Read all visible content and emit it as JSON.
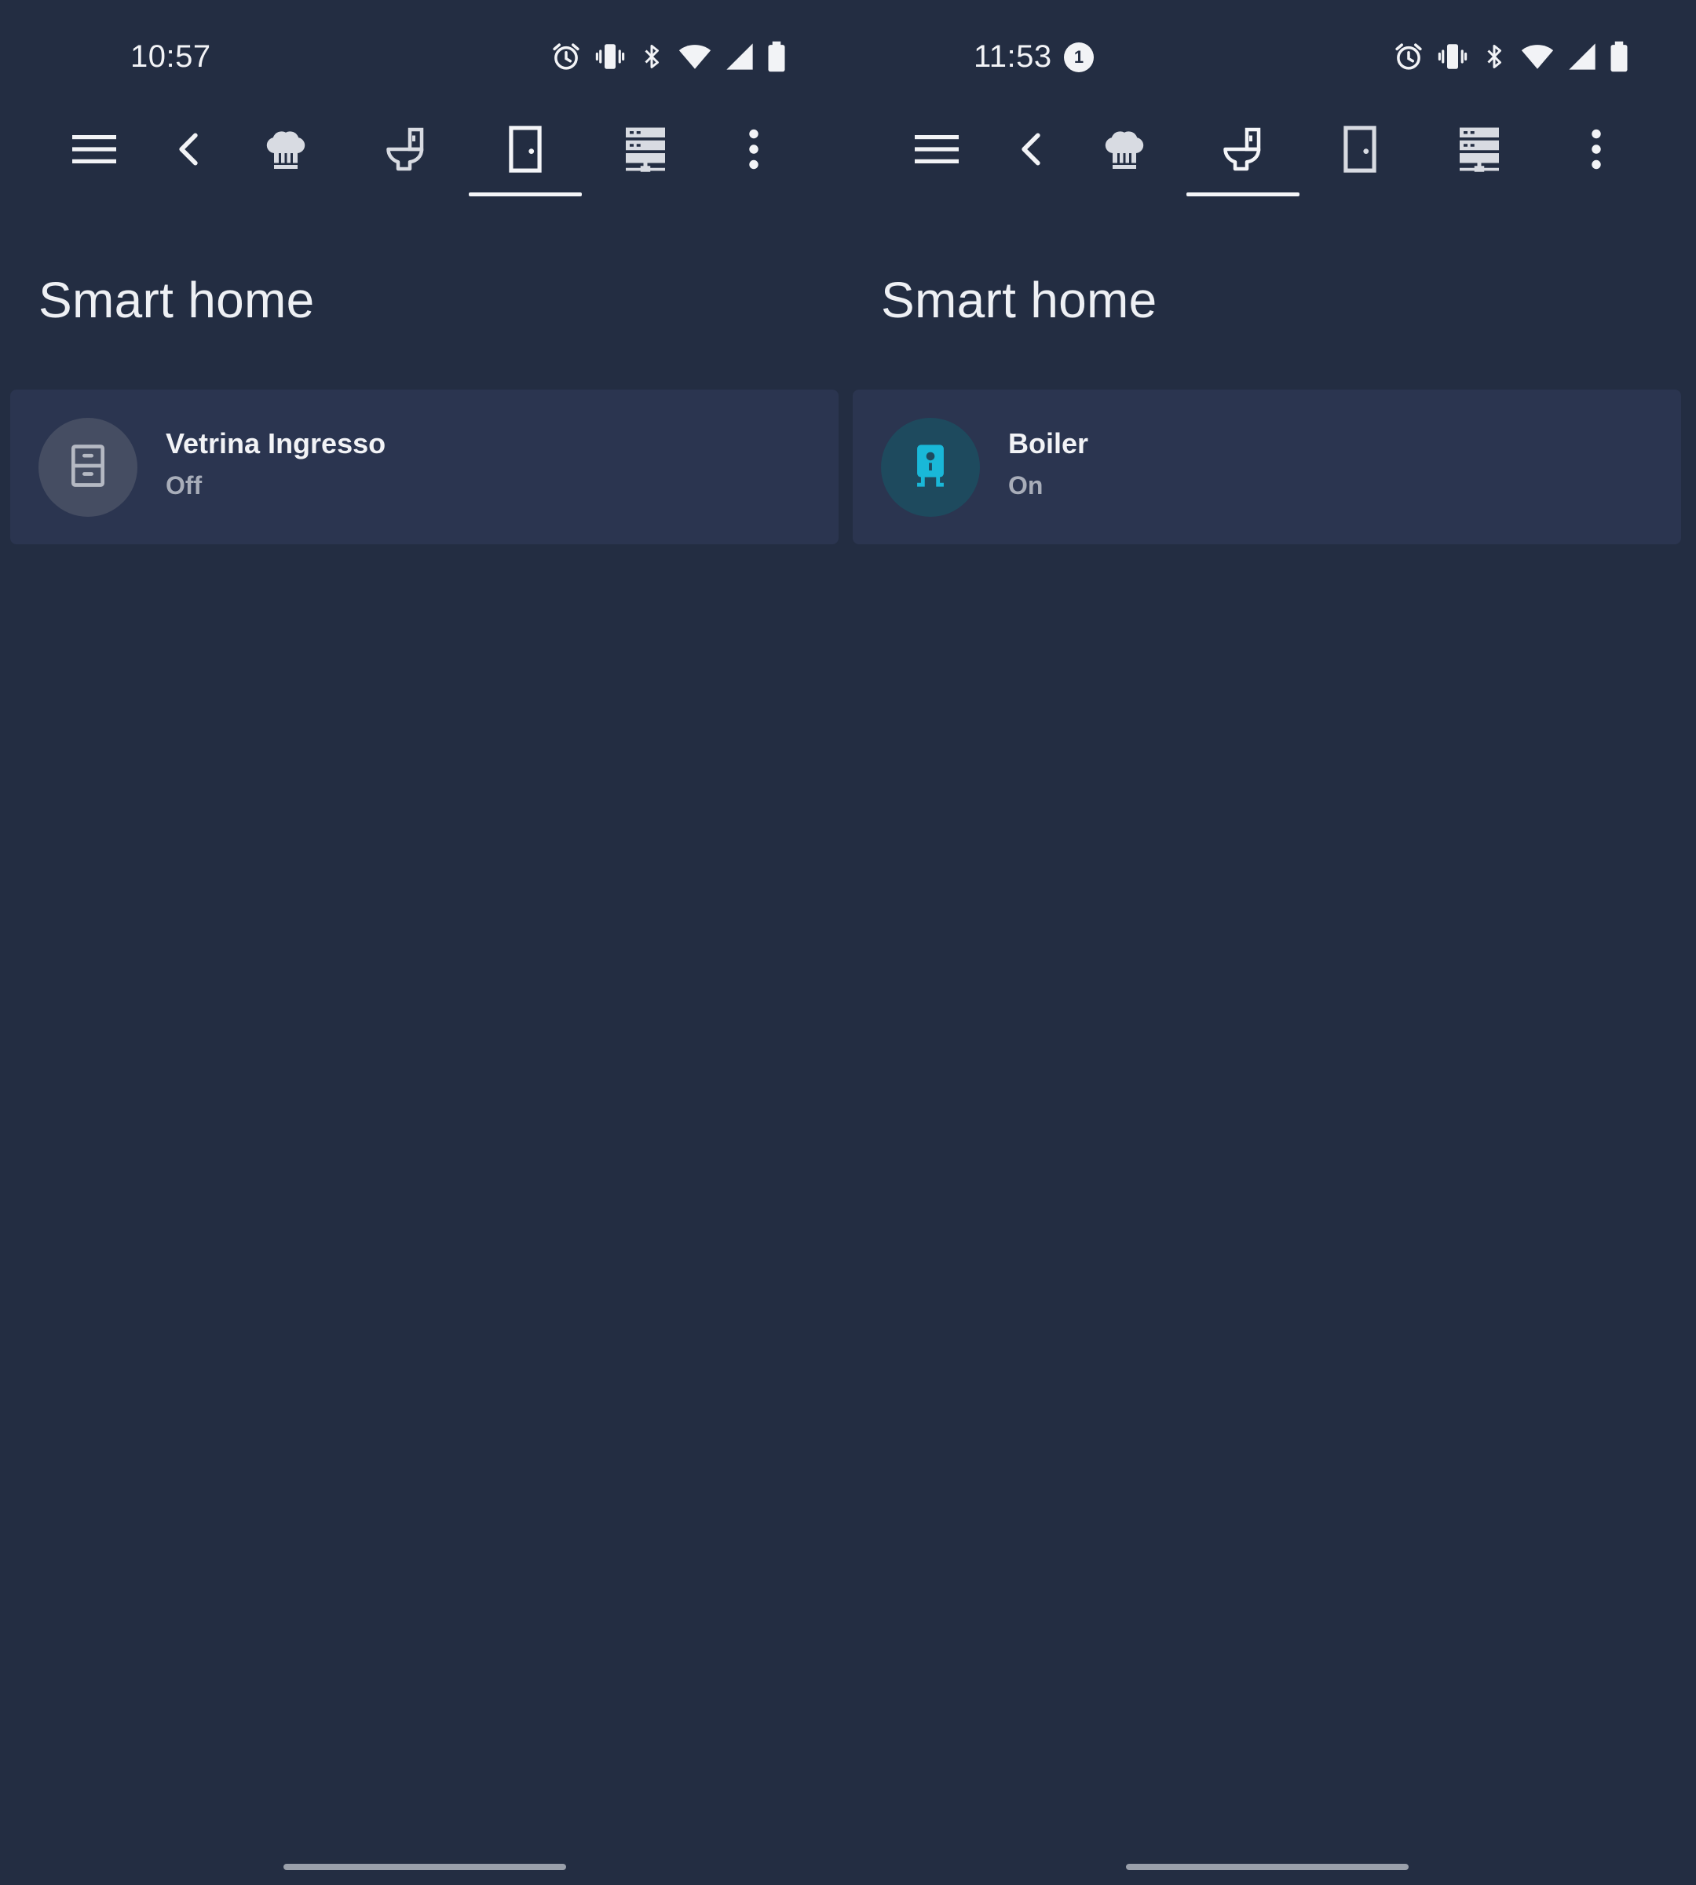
{
  "colors": {
    "background": "#232d42",
    "card": "#2b3550",
    "icon_off_bg": "#454d62",
    "icon_on_bg": "#1e4a5e",
    "icon_on_fg": "#19b8d8",
    "text_primary": "#f2f3f6",
    "text_secondary": "#a8adb9"
  },
  "screens": [
    {
      "status_bar": {
        "time": "10:57",
        "icons": [
          "alarm-icon",
          "vibrate-icon",
          "bluetooth-icon",
          "wifi-icon",
          "signal-icon",
          "battery-icon"
        ]
      },
      "toolbar": {
        "items": [
          "menu-icon",
          "back-icon",
          "chef-hat-icon",
          "toilet-icon",
          "door-icon",
          "server-icon",
          "more-vert-icon"
        ],
        "selected_tab": "door-icon"
      },
      "page_title": "Smart home",
      "entity": {
        "name": "Vetrina Ingresso",
        "state": "Off",
        "icon": "cabinet-icon"
      }
    },
    {
      "status_bar": {
        "time": "11:53",
        "notification_count": "1",
        "icons": [
          "alarm-icon",
          "vibrate-icon",
          "bluetooth-icon",
          "wifi-icon",
          "signal-icon",
          "battery-icon"
        ]
      },
      "toolbar": {
        "items": [
          "menu-icon",
          "back-icon",
          "chef-hat-icon",
          "toilet-icon",
          "door-icon",
          "server-icon",
          "more-vert-icon"
        ],
        "selected_tab": "toilet-icon"
      },
      "page_title": "Smart home",
      "entity": {
        "name": "Boiler",
        "state": "On",
        "icon": "water-boiler-icon"
      }
    }
  ]
}
